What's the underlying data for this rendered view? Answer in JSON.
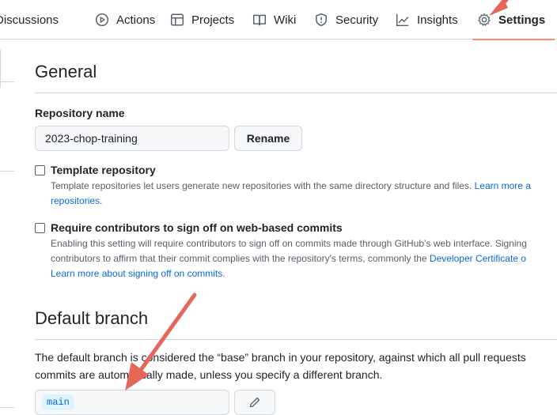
{
  "nav": {
    "tabs": [
      {
        "label": "Discussions",
        "icon": "discussions-icon"
      },
      {
        "label": "Actions",
        "icon": "play-icon"
      },
      {
        "label": "Projects",
        "icon": "table-icon"
      },
      {
        "label": "Wiki",
        "icon": "book-icon"
      },
      {
        "label": "Security",
        "icon": "shield-icon"
      },
      {
        "label": "Insights",
        "icon": "graph-icon"
      },
      {
        "label": "Settings",
        "icon": "gear-icon",
        "active": true
      }
    ]
  },
  "general": {
    "heading": "General",
    "repo_name_label": "Repository name",
    "repo_name_value": "2023-chop-training",
    "rename_button": "Rename",
    "template": {
      "title": "Template repository",
      "desc_line1": "Template repositories let users generate new repositories with the same directory structure and files.",
      "link1": "Learn more a",
      "link2": "repositories",
      "suffix2": "."
    },
    "signoff": {
      "title": "Require contributors to sign off on web-based commits",
      "desc_line1": "Enabling this setting will require contributors to sign off on commits made through GitHub’s web interface. Signing",
      "desc_line2": "contributors to affirm that their commit complies with the repository's terms, commonly the",
      "link_dco": "Developer Certificate o",
      "link_learn": "Learn more about signing off on commits",
      "suffix": "."
    }
  },
  "default_branch": {
    "heading": "Default branch",
    "desc_line1": "The default branch is considered the “base” branch in your repository, against which all pull requests",
    "desc_line2": "commits are automatically made, unless you specify a different branch.",
    "branch": "main"
  },
  "colors": {
    "accent_underline": "#fd8c73",
    "arrow": "#e5675a",
    "link": "#0969da"
  }
}
